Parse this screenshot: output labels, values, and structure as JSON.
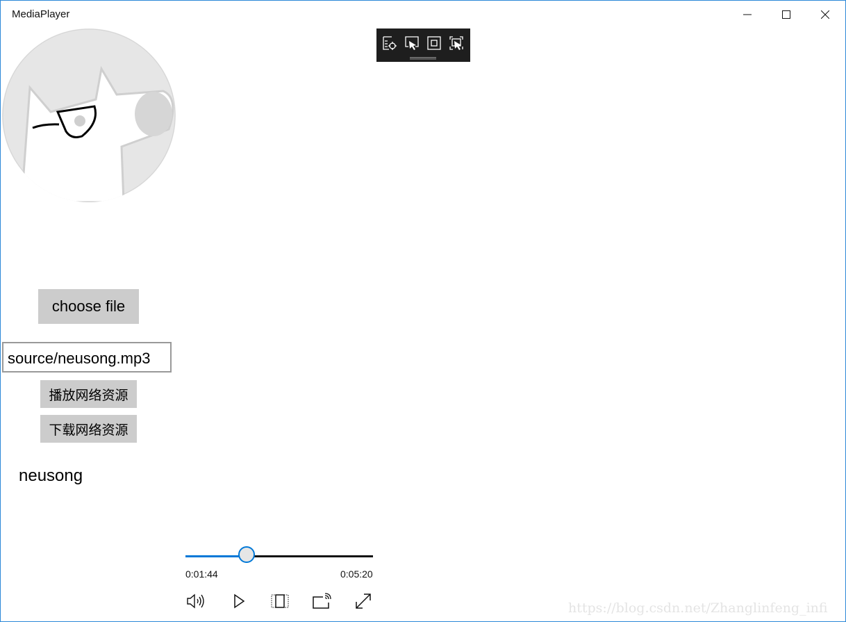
{
  "window": {
    "title": "MediaPlayer",
    "accent": "#2b88d8"
  },
  "caption_buttons": {
    "minimize": "minimize-icon",
    "maximize": "maximize-icon",
    "close": "close-icon"
  },
  "debug_toolbar": {
    "icons": [
      "select-element-icon",
      "display-layout-adorners-icon",
      "track-focused-element-icon",
      "show-selection-icon"
    ]
  },
  "album_art": {
    "description": "cartoon cat with eyepatch"
  },
  "buttons": {
    "choose_file": "choose file",
    "play_network": "播放网络资源",
    "download_network": "下载网络资源"
  },
  "url_input": {
    "value": "source/neusong.mp3"
  },
  "song_name": "neusong",
  "player": {
    "current_time": "0:01:44",
    "total_time": "0:05:20",
    "progress": 0.325,
    "accent": "#0078d7",
    "controls": [
      "volume-icon",
      "play-icon",
      "aspect-ratio-icon",
      "cast-icon",
      "fullscreen-icon"
    ]
  },
  "watermark": "https://blog.csdn.net/Zhanglinfeng_infi"
}
